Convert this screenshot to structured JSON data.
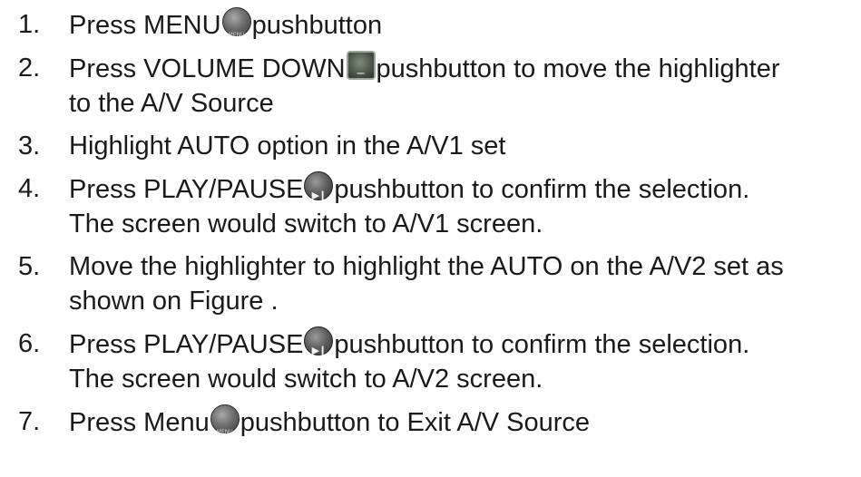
{
  "steps": [
    {
      "number": "1.",
      "before": "Press MENU",
      "icon": "menu-button-icon",
      "after": "pushbutton",
      "second_line": ""
    },
    {
      "number": "2.",
      "before": "Press VOLUME DOWN",
      "icon": "volume-down-button-icon",
      "after": "pushbutton to move the highlighter",
      "second_line": "to the A/V Source"
    },
    {
      "number": "3.",
      "before": "Highlight AUTO option in the A/V1 set",
      "icon": "",
      "after": "",
      "second_line": ""
    },
    {
      "number": "4.",
      "before": "Press PLAY/PAUSE",
      "icon": "play-pause-button-icon",
      "after": "pushbutton to confirm the selection.",
      "second_line": "The screen would switch to A/V1 screen."
    },
    {
      "number": "5.",
      "before": "Move the highlighter to highlight the AUTO on the A/V2 set as",
      "icon": "",
      "after": "",
      "second_line": "shown on Figure ."
    },
    {
      "number": "6.",
      "before": "Press PLAY/PAUSE",
      "icon": "play-pause-button-icon",
      "after": "pushbutton to confirm the selection.",
      "second_line": "The screen would switch to A/V2 screen."
    },
    {
      "number": "7.",
      "before": "Press Menu",
      "icon": "menu-button-icon",
      "after": "pushbutton to Exit A/V Source",
      "second_line": ""
    }
  ]
}
